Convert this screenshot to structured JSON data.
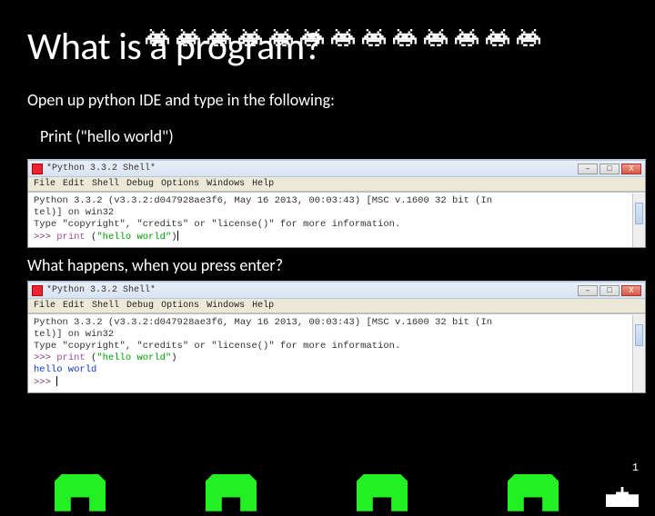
{
  "title": "What is a program?",
  "instruction": "Open up python IDE and type in the following:",
  "code_line": "Print (\"hello world\")",
  "question": "What happens, when you press enter?",
  "score": "1",
  "idle": {
    "window_title": "*Python 3.3.2 Shell*",
    "menu": [
      "File",
      "Edit",
      "Shell",
      "Debug",
      "Options",
      "Windows",
      "Help"
    ]
  },
  "shell1": {
    "banner1": "Python 3.3.2 (v3.3.2:d047928ae3f6, May 16 2013, 00:03:43) [MSC v.1600 32 bit (In",
    "banner2": "tel)] on win32",
    "banner3": "Type \"copyright\", \"credits\" or \"license()\" for more information.",
    "prompt": ">>>",
    "stmt_kw": "print",
    "stmt_paren_open": " (",
    "stmt_str": "\"hello world\"",
    "stmt_paren_close": ")"
  },
  "shell2": {
    "banner1": "Python 3.3.2 (v3.3.2:d047928ae3f6, May 16 2013, 00:03:43) [MSC v.1600 32 bit (In",
    "banner2": "tel)] on win32",
    "banner3": "Type \"copyright\", \"credits\" or \"license()\" for more information.",
    "prompt": ">>>",
    "stmt_kw": "print",
    "stmt_paren_open": " (",
    "stmt_str": "\"hello world\"",
    "stmt_paren_close": ")",
    "output": "hello world"
  }
}
